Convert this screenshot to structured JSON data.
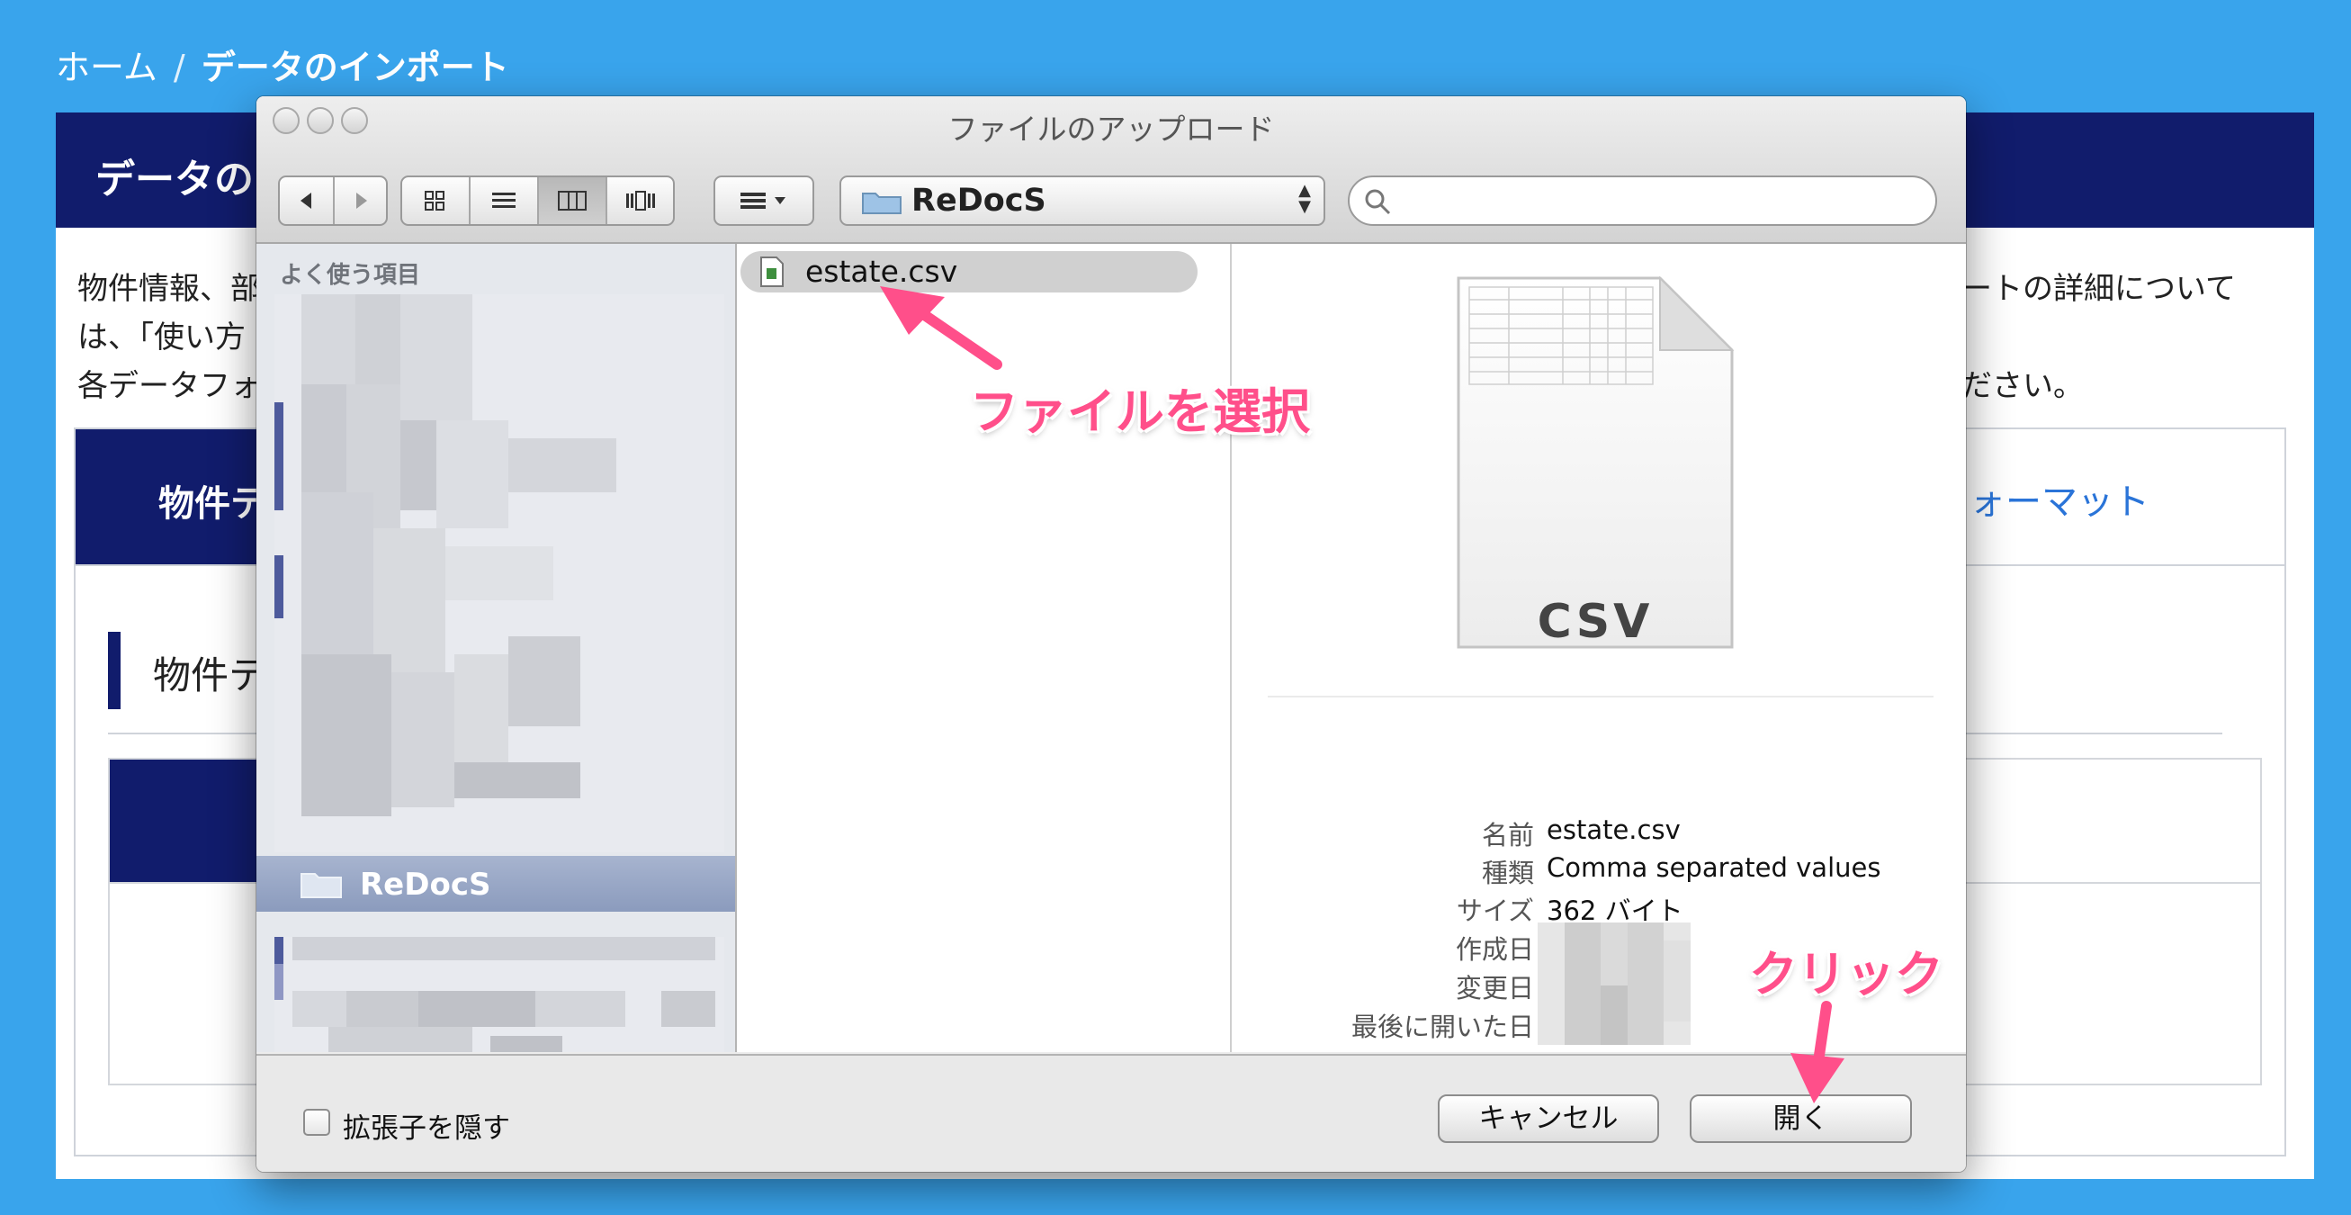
{
  "breadcrumb": {
    "home": "ホーム",
    "separator": "/",
    "current": "データのインポート"
  },
  "page": {
    "title": "データの",
    "intro_line1": "物件情報、部",
    "intro_line2": "は、「使い方",
    "intro_line3": "各データフォ",
    "intro_right1": "ートの詳細について",
    "intro_right3": "ださい。",
    "tab_active": "物件テ",
    "tab_format": "ォーマット",
    "section_title": "物件テ"
  },
  "dialog": {
    "title": "ファイルのアップロード",
    "path": "ReDocS",
    "search_placeholder": "",
    "sidebar_heading": "よく使う項目",
    "sidebar_selected": "ReDocS",
    "file_name": "estate.csv",
    "preview_label": "CSV",
    "info": [
      {
        "key": "名前",
        "value": "estate.csv"
      },
      {
        "key": "種類",
        "value": "Comma separated values"
      },
      {
        "key": "サイズ",
        "value": "362 バイト"
      },
      {
        "key": "作成日",
        "value": ""
      },
      {
        "key": "変更日",
        "value": ""
      },
      {
        "key": "最後に開いた日",
        "value": ""
      }
    ],
    "hide_extension": "拡張子を隠す",
    "cancel": "キャンセル",
    "open": "開く"
  },
  "annotations": {
    "select_file": "ファイルを選択",
    "click": "クリック"
  },
  "colors": {
    "background": "#39a4ec",
    "header_navy": "#111c6c",
    "annotation": "#ff4f8a"
  }
}
